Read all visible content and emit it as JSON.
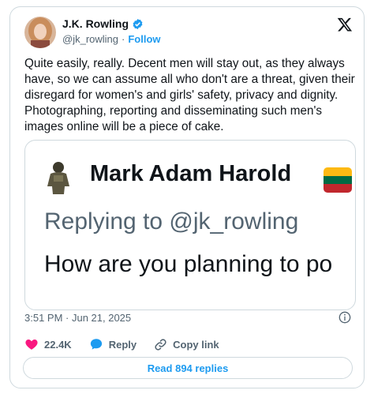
{
  "author": {
    "name": "J.K. Rowling",
    "handle": "@jk_rowling",
    "separator": "·",
    "follow_label": "Follow",
    "verified_icon": "verified-badge-icon"
  },
  "tweet": {
    "text": "Quite easily, really. Decent men will stay out, as they always have, so we can assume all who don't are a threat, given their disregard for women's and girls' safety, privacy and dignity. Photographing, reporting and disseminating such men's images online will be a piece of cake.",
    "timestamp": "3:51 PM · Jun 21, 2025"
  },
  "quoted": {
    "name": "Mark Adam Harold",
    "replying_to": "Replying to @jk_rowling",
    "text": "How are you planning to po",
    "flag_colors": [
      "#fdb913",
      "#006a44",
      "#c1272d"
    ]
  },
  "actions": {
    "likes": "22.4K",
    "reply_label": "Reply",
    "copy_label": "Copy link"
  },
  "read_replies": "Read 894 replies",
  "colors": {
    "accent": "#1d9bf0",
    "like": "#f91880",
    "muted": "#536471",
    "border": "#cfd9de"
  }
}
